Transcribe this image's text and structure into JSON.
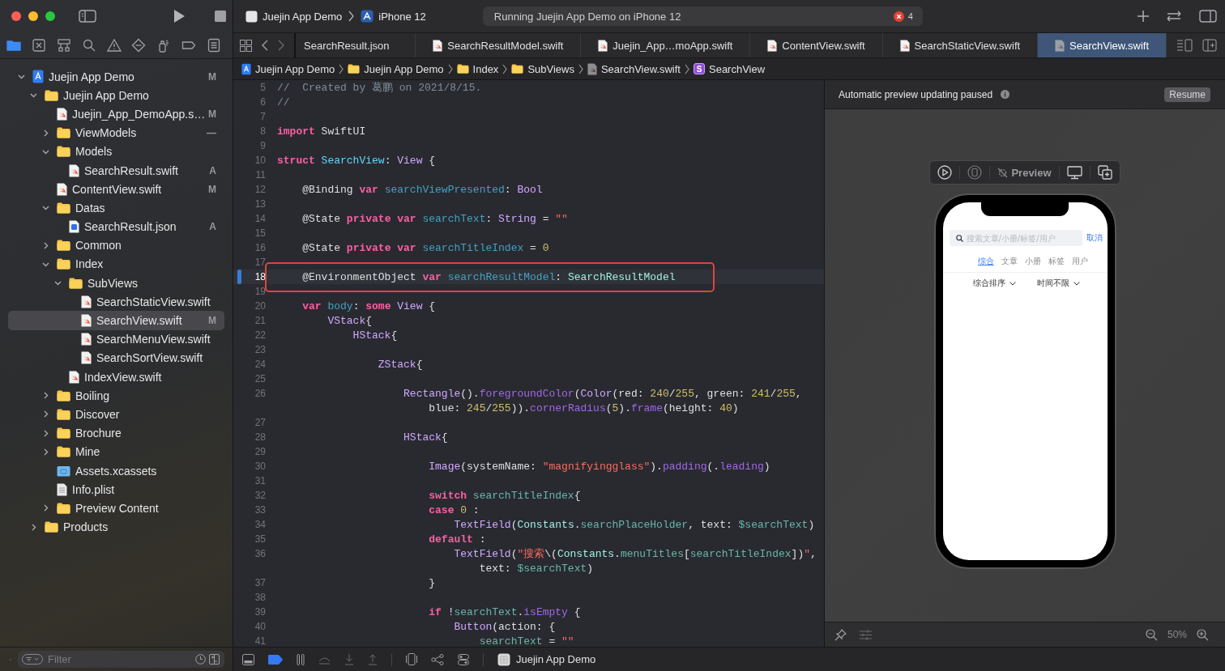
{
  "toolbar": {
    "scheme": "Juejin App Demo",
    "device": "iPhone 12",
    "status": "Running Juejin App Demo on iPhone 12",
    "error_count": "4"
  },
  "navigator_tabs": [
    {
      "kind": "project",
      "selected": true
    },
    {
      "kind": "source-control",
      "selected": false
    },
    {
      "kind": "symbols",
      "selected": false
    },
    {
      "kind": "find",
      "selected": false
    },
    {
      "kind": "issues",
      "selected": false
    },
    {
      "kind": "tests",
      "selected": false
    },
    {
      "kind": "debug",
      "selected": false
    },
    {
      "kind": "breakpoints",
      "selected": false
    },
    {
      "kind": "reports",
      "selected": false
    }
  ],
  "sidebar": {
    "items": [
      {
        "name": "Juejin App Demo",
        "kind": "project",
        "expanded": true,
        "badge": "M",
        "selected": false,
        "children": [
          {
            "name": "Juejin App Demo",
            "kind": "folder",
            "expanded": true,
            "selected": false,
            "children": [
              {
                "name": "Juejin_App_DemoApp.s…",
                "kind": "swift",
                "badge": "M",
                "selected": false
              },
              {
                "name": "ViewModels",
                "kind": "folder",
                "expanded": false,
                "badge": "—",
                "selected": false
              },
              {
                "name": "Models",
                "kind": "folder",
                "expanded": true,
                "selected": false,
                "children": [
                  {
                    "name": "SearchResult.swift",
                    "kind": "swift",
                    "badge": "A",
                    "selected": false
                  }
                ]
              },
              {
                "name": "ContentView.swift",
                "kind": "swift",
                "badge": "M",
                "selected": false
              },
              {
                "name": "Datas",
                "kind": "folder",
                "expanded": true,
                "selected": false,
                "children": [
                  {
                    "name": "SearchResult.json",
                    "kind": "json",
                    "badge": "A",
                    "selected": false
                  }
                ]
              },
              {
                "name": "Common",
                "kind": "folder",
                "expanded": false,
                "selected": false
              },
              {
                "name": "Index",
                "kind": "folder",
                "expanded": true,
                "selected": false,
                "children": [
                  {
                    "name": "SubViews",
                    "kind": "folder",
                    "expanded": true,
                    "selected": false,
                    "children": [
                      {
                        "name": "SearchStaticView.swift",
                        "kind": "swift",
                        "selected": false
                      },
                      {
                        "name": "SearchView.swift",
                        "kind": "swift",
                        "badge": "M",
                        "selected": true
                      },
                      {
                        "name": "SearchMenuView.swift",
                        "kind": "swift",
                        "selected": false
                      },
                      {
                        "name": "SearchSortView.swift",
                        "kind": "swift",
                        "selected": false
                      }
                    ]
                  },
                  {
                    "name": "IndexView.swift",
                    "kind": "swift",
                    "selected": false
                  }
                ]
              },
              {
                "name": "Boiling",
                "kind": "folder",
                "expanded": false,
                "selected": false
              },
              {
                "name": "Discover",
                "kind": "folder",
                "expanded": false,
                "selected": false
              },
              {
                "name": "Brochure",
                "kind": "folder",
                "expanded": false,
                "selected": false
              },
              {
                "name": "Mine",
                "kind": "folder",
                "expanded": false,
                "selected": false
              },
              {
                "name": "Assets.xcassets",
                "kind": "assets",
                "selected": false
              },
              {
                "name": "Info.plist",
                "kind": "plist",
                "selected": false
              },
              {
                "name": "Preview Content",
                "kind": "folder",
                "expanded": false,
                "selected": false
              }
            ]
          },
          {
            "name": "Products",
            "kind": "folder",
            "expanded": false,
            "selected": false
          }
        ]
      }
    ],
    "filter": {
      "placeholder": "Filter"
    }
  },
  "tabs": [
    {
      "label": "SearchResult.json",
      "kind": "json",
      "selected": false
    },
    {
      "label": "SearchResultModel.swift",
      "kind": "swift",
      "selected": false
    },
    {
      "label": "Juejin_App…moApp.swift",
      "kind": "swift",
      "selected": false
    },
    {
      "label": "ContentView.swift",
      "kind": "swift",
      "selected": false
    },
    {
      "label": "SearchStaticView.swift",
      "kind": "swift",
      "selected": false
    },
    {
      "label": "SearchView.swift",
      "kind": "swift",
      "selected": true
    }
  ],
  "jump_bar": [
    {
      "kind": "project",
      "label": "Juejin App Demo"
    },
    {
      "kind": "folder",
      "label": "Juejin App Demo"
    },
    {
      "kind": "folder",
      "label": "Index"
    },
    {
      "kind": "folder",
      "label": "SubViews"
    },
    {
      "kind": "swift",
      "label": "SearchView.swift"
    },
    {
      "kind": "struct",
      "symbol": "S",
      "label": "SearchView"
    }
  ],
  "editor": {
    "lines": [
      {
        "number": "5",
        "current": false,
        "boxed": false,
        "tokens": [
          {
            "kind": "comment",
            "text": "//  Created by 葛鹏 on 2021/8/15."
          }
        ]
      },
      {
        "number": "6",
        "current": false,
        "boxed": false,
        "tokens": [
          {
            "kind": "comment",
            "text": "//"
          }
        ]
      },
      {
        "number": "7",
        "current": false,
        "boxed": false
      },
      {
        "number": "8",
        "current": false,
        "boxed": false,
        "tokens": [
          {
            "kind": "keyword",
            "text": "import"
          },
          {
            "kind": "plain",
            "text": " SwiftUI"
          }
        ]
      },
      {
        "number": "9",
        "current": false,
        "boxed": false
      },
      {
        "number": "10",
        "current": false,
        "boxed": false,
        "tokens": [
          {
            "kind": "keyword",
            "text": "struct"
          },
          {
            "kind": "decl",
            "text": " SearchView"
          },
          {
            "kind": "plain",
            "text": ": "
          },
          {
            "kind": "type",
            "text": "View"
          },
          {
            "kind": "plain",
            "text": " {"
          }
        ]
      },
      {
        "number": "11",
        "current": false,
        "boxed": false
      },
      {
        "number": "12",
        "current": false,
        "boxed": false,
        "tokens": [
          {
            "kind": "plain",
            "text": "    @Binding "
          },
          {
            "kind": "keyword",
            "text": "var"
          },
          {
            "kind": "prop",
            "text": " searchViewPresented"
          },
          {
            "kind": "plain",
            "text": ": "
          },
          {
            "kind": "type",
            "text": "Bool"
          }
        ]
      },
      {
        "number": "13",
        "current": false,
        "boxed": false
      },
      {
        "number": "14",
        "current": false,
        "boxed": false,
        "tokens": [
          {
            "kind": "plain",
            "text": "    @State "
          },
          {
            "kind": "keyword",
            "text": "private"
          },
          {
            "kind": "keyword",
            "text": " var"
          },
          {
            "kind": "prop",
            "text": " searchText"
          },
          {
            "kind": "plain",
            "text": ": "
          },
          {
            "kind": "type",
            "text": "String"
          },
          {
            "kind": "plain",
            "text": " = "
          },
          {
            "kind": "string",
            "text": "\"\""
          }
        ]
      },
      {
        "number": "15",
        "current": false,
        "boxed": false
      },
      {
        "number": "16",
        "current": false,
        "boxed": false,
        "tokens": [
          {
            "kind": "plain",
            "text": "    @State "
          },
          {
            "kind": "keyword",
            "text": "private"
          },
          {
            "kind": "keyword",
            "text": " var"
          },
          {
            "kind": "prop",
            "text": " searchTitleIndex"
          },
          {
            "kind": "plain",
            "text": " = "
          },
          {
            "kind": "number",
            "text": "0"
          }
        ]
      },
      {
        "number": "17",
        "current": false,
        "boxed": false
      },
      {
        "number": "18",
        "current": true,
        "boxed": true,
        "tokens": [
          {
            "kind": "plain",
            "text": "    @EnvironmentObject "
          },
          {
            "kind": "keyword",
            "text": "var"
          },
          {
            "kind": "prop",
            "text": " searchResultModel"
          },
          {
            "kind": "plain",
            "text": ": "
          },
          {
            "kind": "projtype",
            "text": "SearchResultModel"
          }
        ]
      },
      {
        "number": "19",
        "current": false,
        "boxed": false
      },
      {
        "number": "20",
        "current": false,
        "boxed": false,
        "tokens": [
          {
            "kind": "keyword",
            "text": "    var"
          },
          {
            "kind": "prop",
            "text": " body"
          },
          {
            "kind": "plain",
            "text": ": "
          },
          {
            "kind": "keyword",
            "text": "some"
          },
          {
            "kind": "type",
            "text": " View"
          },
          {
            "kind": "plain",
            "text": " {"
          }
        ]
      },
      {
        "number": "21",
        "current": false,
        "boxed": false,
        "tokens": [
          {
            "kind": "type",
            "text": "        VStack"
          },
          {
            "kind": "plain",
            "text": "{"
          }
        ]
      },
      {
        "number": "22",
        "current": false,
        "boxed": false,
        "tokens": [
          {
            "kind": "type",
            "text": "            HStack"
          },
          {
            "kind": "plain",
            "text": "{"
          }
        ]
      },
      {
        "number": "23",
        "current": false,
        "boxed": false
      },
      {
        "number": "24",
        "current": false,
        "boxed": false,
        "tokens": [
          {
            "kind": "type",
            "text": "                ZStack"
          },
          {
            "kind": "plain",
            "text": "{"
          }
        ]
      },
      {
        "number": "25",
        "current": false,
        "boxed": false
      },
      {
        "number": "26",
        "current": false,
        "boxed": false,
        "tokens": [
          {
            "kind": "type",
            "text": "                    Rectangle"
          },
          {
            "kind": "plain",
            "text": "()."
          },
          {
            "kind": "method",
            "text": "foregroundColor"
          },
          {
            "kind": "plain",
            "text": "("
          },
          {
            "kind": "type",
            "text": "Color"
          },
          {
            "kind": "plain",
            "text": "(red: "
          },
          {
            "kind": "number",
            "text": "240"
          },
          {
            "kind": "plain",
            "text": "/"
          },
          {
            "kind": "number",
            "text": "255"
          },
          {
            "kind": "plain",
            "text": ", green: "
          },
          {
            "kind": "number",
            "text": "241"
          },
          {
            "kind": "plain",
            "text": "/"
          },
          {
            "kind": "number",
            "text": "255"
          },
          {
            "kind": "plain",
            "text": ","
          }
        ],
        "wrapped": [
          {
            "kind": "plain",
            "text": "                        blue: "
          },
          {
            "kind": "number",
            "text": "245"
          },
          {
            "kind": "plain",
            "text": "/"
          },
          {
            "kind": "number",
            "text": "255"
          },
          {
            "kind": "plain",
            "text": "))."
          },
          {
            "kind": "method",
            "text": "cornerRadius"
          },
          {
            "kind": "plain",
            "text": "("
          },
          {
            "kind": "number",
            "text": "5"
          },
          {
            "kind": "plain",
            "text": ")."
          },
          {
            "kind": "method",
            "text": "frame"
          },
          {
            "kind": "plain",
            "text": "(height: "
          },
          {
            "kind": "number",
            "text": "40"
          },
          {
            "kind": "plain",
            "text": ")"
          }
        ]
      },
      {
        "number": "27",
        "current": false,
        "boxed": false
      },
      {
        "number": "28",
        "current": false,
        "boxed": false,
        "tokens": [
          {
            "kind": "type",
            "text": "                    HStack"
          },
          {
            "kind": "plain",
            "text": "{"
          }
        ]
      },
      {
        "number": "29",
        "current": false,
        "boxed": false
      },
      {
        "number": "30",
        "current": false,
        "boxed": false,
        "tokens": [
          {
            "kind": "type",
            "text": "                        Image"
          },
          {
            "kind": "plain",
            "text": "(systemName: "
          },
          {
            "kind": "string",
            "text": "\"magnifyingglass\""
          },
          {
            "kind": "plain",
            "text": ")."
          },
          {
            "kind": "method",
            "text": "padding"
          },
          {
            "kind": "plain",
            "text": "(."
          },
          {
            "kind": "method",
            "text": "leading"
          },
          {
            "kind": "plain",
            "text": ")"
          }
        ]
      },
      {
        "number": "31",
        "current": false,
        "boxed": false
      },
      {
        "number": "32",
        "current": false,
        "boxed": false,
        "tokens": [
          {
            "kind": "keyword",
            "text": "                        switch"
          },
          {
            "kind": "projident",
            "text": " searchTitleIndex"
          },
          {
            "kind": "plain",
            "text": "{"
          }
        ]
      },
      {
        "number": "33",
        "current": false,
        "boxed": false,
        "tokens": [
          {
            "kind": "keyword",
            "text": "                        case"
          },
          {
            "kind": "number",
            "text": " 0"
          },
          {
            "kind": "plain",
            "text": " :"
          }
        ]
      },
      {
        "number": "34",
        "current": false,
        "boxed": false,
        "tokens": [
          {
            "kind": "type",
            "text": "                            TextField"
          },
          {
            "kind": "plain",
            "text": "("
          },
          {
            "kind": "projtype",
            "text": "Constants"
          },
          {
            "kind": "plain",
            "text": "."
          },
          {
            "kind": "projident",
            "text": "searchPlaceHolder"
          },
          {
            "kind": "plain",
            "text": ", text: "
          },
          {
            "kind": "projident",
            "text": "$searchText"
          },
          {
            "kind": "plain",
            "text": ")"
          }
        ]
      },
      {
        "number": "35",
        "current": false,
        "boxed": false,
        "tokens": [
          {
            "kind": "keyword",
            "text": "                        default"
          },
          {
            "kind": "plain",
            "text": " :"
          }
        ]
      },
      {
        "number": "36",
        "current": false,
        "boxed": false,
        "tokens": [
          {
            "kind": "type",
            "text": "                            TextField"
          },
          {
            "kind": "plain",
            "text": "("
          },
          {
            "kind": "string",
            "text": "\"搜索"
          },
          {
            "kind": "plain",
            "text": "\\("
          },
          {
            "kind": "projtype",
            "text": "Constants"
          },
          {
            "kind": "plain",
            "text": "."
          },
          {
            "kind": "projident",
            "text": "menuTitles"
          },
          {
            "kind": "plain",
            "text": "["
          },
          {
            "kind": "projident",
            "text": "searchTitleIndex"
          },
          {
            "kind": "plain",
            "text": "])"
          },
          {
            "kind": "string",
            "text": "\""
          },
          {
            "kind": "plain",
            "text": ","
          }
        ],
        "wrapped": [
          {
            "kind": "plain",
            "text": "                                text: "
          },
          {
            "kind": "projident",
            "text": "$searchText"
          },
          {
            "kind": "plain",
            "text": ")"
          }
        ]
      },
      {
        "number": "37",
        "current": false,
        "boxed": false,
        "tokens": [
          {
            "kind": "plain",
            "text": "                        }"
          }
        ]
      },
      {
        "number": "38",
        "current": false,
        "boxed": false
      },
      {
        "number": "39",
        "current": false,
        "boxed": false,
        "tokens": [
          {
            "kind": "keyword",
            "text": "                        if"
          },
          {
            "kind": "plain",
            "text": " !"
          },
          {
            "kind": "projident",
            "text": "searchText"
          },
          {
            "kind": "plain",
            "text": "."
          },
          {
            "kind": "method",
            "text": "isEmpty"
          },
          {
            "kind": "plain",
            "text": " {"
          }
        ]
      },
      {
        "number": "40",
        "current": false,
        "boxed": false,
        "tokens": [
          {
            "kind": "type",
            "text": "                            Button"
          },
          {
            "kind": "plain",
            "text": "(action: {"
          }
        ]
      },
      {
        "number": "41",
        "current": false,
        "boxed": false,
        "tokens": [
          {
            "kind": "projident",
            "text": "                                searchText"
          },
          {
            "kind": "plain",
            "text": " = "
          },
          {
            "kind": "string",
            "text": "\"\""
          }
        ]
      }
    ]
  },
  "canvas": {
    "notice": "Automatic preview updating paused",
    "resume": "Resume",
    "preview_label": "Preview",
    "zoom": "50%",
    "phone": {
      "search_placeholder": "搜索文章/小册/标签/用户",
      "cancel": "取消",
      "tabs": [
        {
          "label": "综合",
          "selected": true
        },
        {
          "label": "文章",
          "selected": false
        },
        {
          "label": "小册",
          "selected": false
        },
        {
          "label": "标签",
          "selected": false
        },
        {
          "label": "用户",
          "selected": false
        }
      ],
      "sorts": [
        "综合排序",
        "时间不限"
      ]
    }
  },
  "debug_bar": {
    "breakpoints_on": true,
    "target": "Juejin App Demo"
  }
}
